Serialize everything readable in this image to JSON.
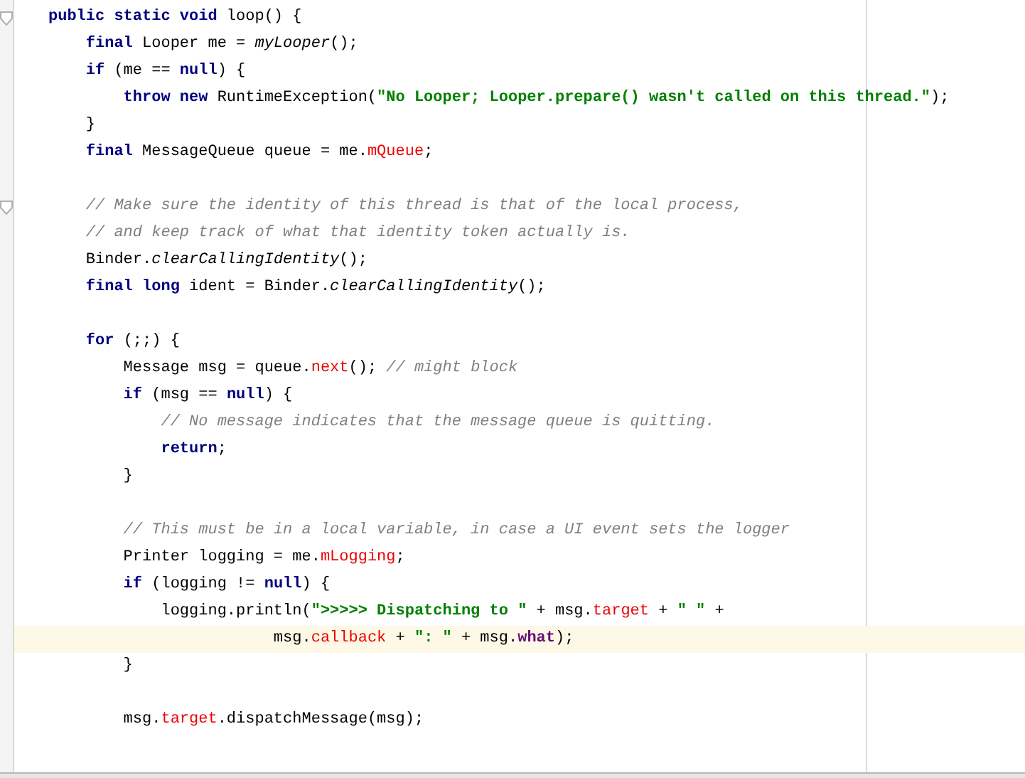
{
  "lines": [
    {
      "kind": "code",
      "current": false,
      "tokens": [
        {
          "kind": "keyword",
          "text": "public static void"
        },
        {
          "kind": "plain",
          "text": " loop() {"
        }
      ]
    },
    {
      "kind": "code",
      "current": false,
      "tokens": [
        {
          "kind": "keyword",
          "text": "    final"
        },
        {
          "kind": "plain",
          "text": " Looper me = "
        },
        {
          "kind": "static",
          "text": "myLooper"
        },
        {
          "kind": "plain",
          "text": "();"
        }
      ]
    },
    {
      "kind": "code",
      "current": false,
      "tokens": [
        {
          "kind": "keyword",
          "text": "    if"
        },
        {
          "kind": "plain",
          "text": " (me == "
        },
        {
          "kind": "keyword",
          "text": "null"
        },
        {
          "kind": "plain",
          "text": ") {"
        }
      ]
    },
    {
      "kind": "code",
      "current": false,
      "tokens": [
        {
          "kind": "keyword",
          "text": "        throw new"
        },
        {
          "kind": "plain",
          "text": " RuntimeException("
        },
        {
          "kind": "string",
          "text": "\"No Looper; Looper.prepare() wasn't called on this thread.\""
        },
        {
          "kind": "plain",
          "text": ");"
        }
      ]
    },
    {
      "kind": "code",
      "current": false,
      "tokens": [
        {
          "kind": "plain",
          "text": "    }"
        }
      ]
    },
    {
      "kind": "code",
      "current": false,
      "tokens": [
        {
          "kind": "keyword",
          "text": "    final"
        },
        {
          "kind": "plain",
          "text": " MessageQueue queue = me."
        },
        {
          "kind": "field",
          "text": "mQueue"
        },
        {
          "kind": "plain",
          "text": ";"
        }
      ]
    },
    {
      "kind": "blank",
      "current": false
    },
    {
      "kind": "code",
      "current": false,
      "tokens": [
        {
          "kind": "comment",
          "text": "    // Make sure the identity of this thread is that of the local process,"
        }
      ]
    },
    {
      "kind": "code",
      "current": false,
      "tokens": [
        {
          "kind": "comment",
          "text": "    // and keep track of what that identity token actually is."
        }
      ]
    },
    {
      "kind": "code",
      "current": false,
      "tokens": [
        {
          "kind": "plain",
          "text": "    Binder."
        },
        {
          "kind": "static",
          "text": "clearCallingIdentity"
        },
        {
          "kind": "plain",
          "text": "();"
        }
      ]
    },
    {
      "kind": "code",
      "current": false,
      "tokens": [
        {
          "kind": "keyword",
          "text": "    final long"
        },
        {
          "kind": "plain",
          "text": " ident = Binder."
        },
        {
          "kind": "static",
          "text": "clearCallingIdentity"
        },
        {
          "kind": "plain",
          "text": "();"
        }
      ]
    },
    {
      "kind": "blank",
      "current": false
    },
    {
      "kind": "code",
      "current": false,
      "tokens": [
        {
          "kind": "keyword",
          "text": "    for"
        },
        {
          "kind": "plain",
          "text": " (;;) {"
        }
      ]
    },
    {
      "kind": "code",
      "current": false,
      "tokens": [
        {
          "kind": "plain",
          "text": "        Message msg = queue."
        },
        {
          "kind": "field",
          "text": "next"
        },
        {
          "kind": "plain",
          "text": "(); "
        },
        {
          "kind": "comment",
          "text": "// might block"
        }
      ]
    },
    {
      "kind": "code",
      "current": false,
      "tokens": [
        {
          "kind": "keyword",
          "text": "        if"
        },
        {
          "kind": "plain",
          "text": " (msg == "
        },
        {
          "kind": "keyword",
          "text": "null"
        },
        {
          "kind": "plain",
          "text": ") {"
        }
      ]
    },
    {
      "kind": "code",
      "current": false,
      "tokens": [
        {
          "kind": "comment",
          "text": "            // No message indicates that the message queue is quitting."
        }
      ]
    },
    {
      "kind": "code",
      "current": false,
      "tokens": [
        {
          "kind": "keyword",
          "text": "            return"
        },
        {
          "kind": "plain",
          "text": ";"
        }
      ]
    },
    {
      "kind": "code",
      "current": false,
      "tokens": [
        {
          "kind": "plain",
          "text": "        }"
        }
      ]
    },
    {
      "kind": "blank",
      "current": false
    },
    {
      "kind": "code",
      "current": false,
      "tokens": [
        {
          "kind": "comment",
          "text": "        // This must be in a local variable, in case a UI event sets the logger"
        }
      ]
    },
    {
      "kind": "code",
      "current": false,
      "tokens": [
        {
          "kind": "plain",
          "text": "        Printer logging = me."
        },
        {
          "kind": "field",
          "text": "mLogging"
        },
        {
          "kind": "plain",
          "text": ";"
        }
      ]
    },
    {
      "kind": "code",
      "current": false,
      "tokens": [
        {
          "kind": "keyword",
          "text": "        if"
        },
        {
          "kind": "plain",
          "text": " (logging != "
        },
        {
          "kind": "keyword",
          "text": "null"
        },
        {
          "kind": "plain",
          "text": ") {"
        }
      ]
    },
    {
      "kind": "code",
      "current": false,
      "tokens": [
        {
          "kind": "plain",
          "text": "            logging.println("
        },
        {
          "kind": "string",
          "text": "\">>>>> Dispatching to \""
        },
        {
          "kind": "plain",
          "text": " + msg."
        },
        {
          "kind": "field",
          "text": "target"
        },
        {
          "kind": "plain",
          "text": " + "
        },
        {
          "kind": "string",
          "text": "\" \""
        },
        {
          "kind": "plain",
          "text": " +"
        }
      ]
    },
    {
      "kind": "code",
      "current": true,
      "tokens": [
        {
          "kind": "plain",
          "text": "                        msg."
        },
        {
          "kind": "field",
          "text": "callback"
        },
        {
          "kind": "plain",
          "text": " + "
        },
        {
          "kind": "string",
          "text": "\": \""
        },
        {
          "kind": "plain",
          "text": " + msg."
        },
        {
          "kind": "constant",
          "text": "what"
        },
        {
          "kind": "plain",
          "text": ");"
        }
      ]
    },
    {
      "kind": "code",
      "current": false,
      "tokens": [
        {
          "kind": "plain",
          "text": "        }"
        }
      ]
    },
    {
      "kind": "blank",
      "current": false
    },
    {
      "kind": "code",
      "current": false,
      "tokens": [
        {
          "kind": "plain",
          "text": "        msg."
        },
        {
          "kind": "field",
          "text": "target"
        },
        {
          "kind": "plain",
          "text": ".dispatchMessage(msg);"
        }
      ]
    },
    {
      "kind": "blank",
      "current": false
    }
  ]
}
